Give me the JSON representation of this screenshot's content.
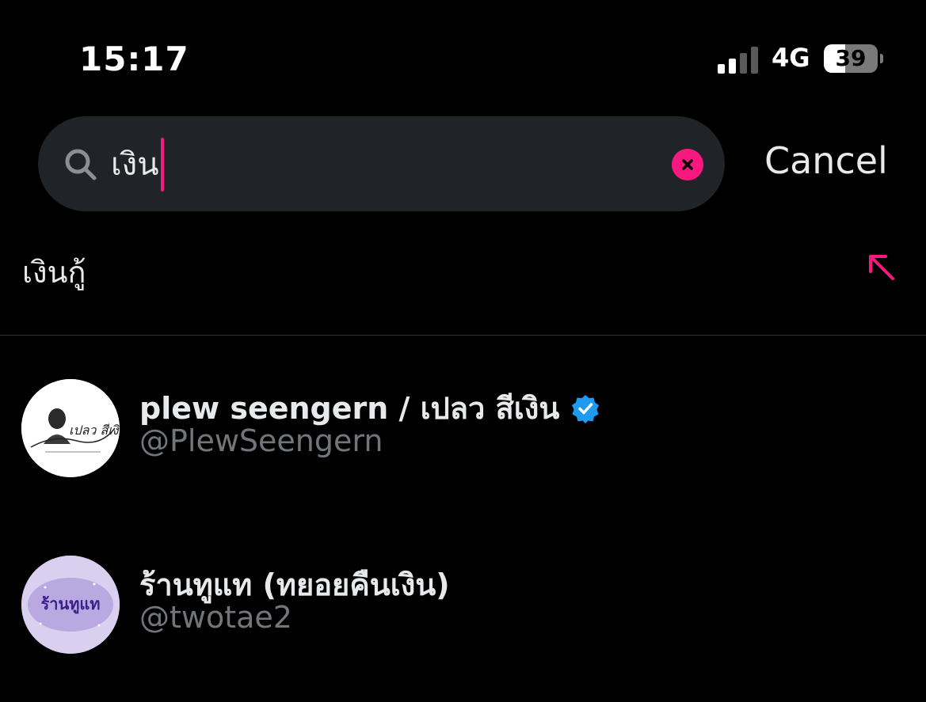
{
  "status_bar": {
    "time": "15:17",
    "network": "4G",
    "battery_percent": "39",
    "battery_level": 0.39,
    "signal_bars_active": 2,
    "signal_bars_total": 4
  },
  "search": {
    "query": "เงิน",
    "cancel_label": "Cancel"
  },
  "suggestion": {
    "text": "เงินกู้"
  },
  "users": [
    {
      "name": "plew seengern / เปลว สีเงิน",
      "handle": "@PlewSeengern",
      "verified": true,
      "avatar_text": "เปลว สีเงิน"
    },
    {
      "name": "ร้านทูแท (ทยอยคืนเงิน)",
      "handle": "@twotae2",
      "verified": false,
      "avatar_text": "ร้านทูแท"
    }
  ],
  "colors": {
    "accent": "#f91880",
    "verified": "#1d9bf0",
    "handle": "#71767b",
    "background": "#000000"
  }
}
